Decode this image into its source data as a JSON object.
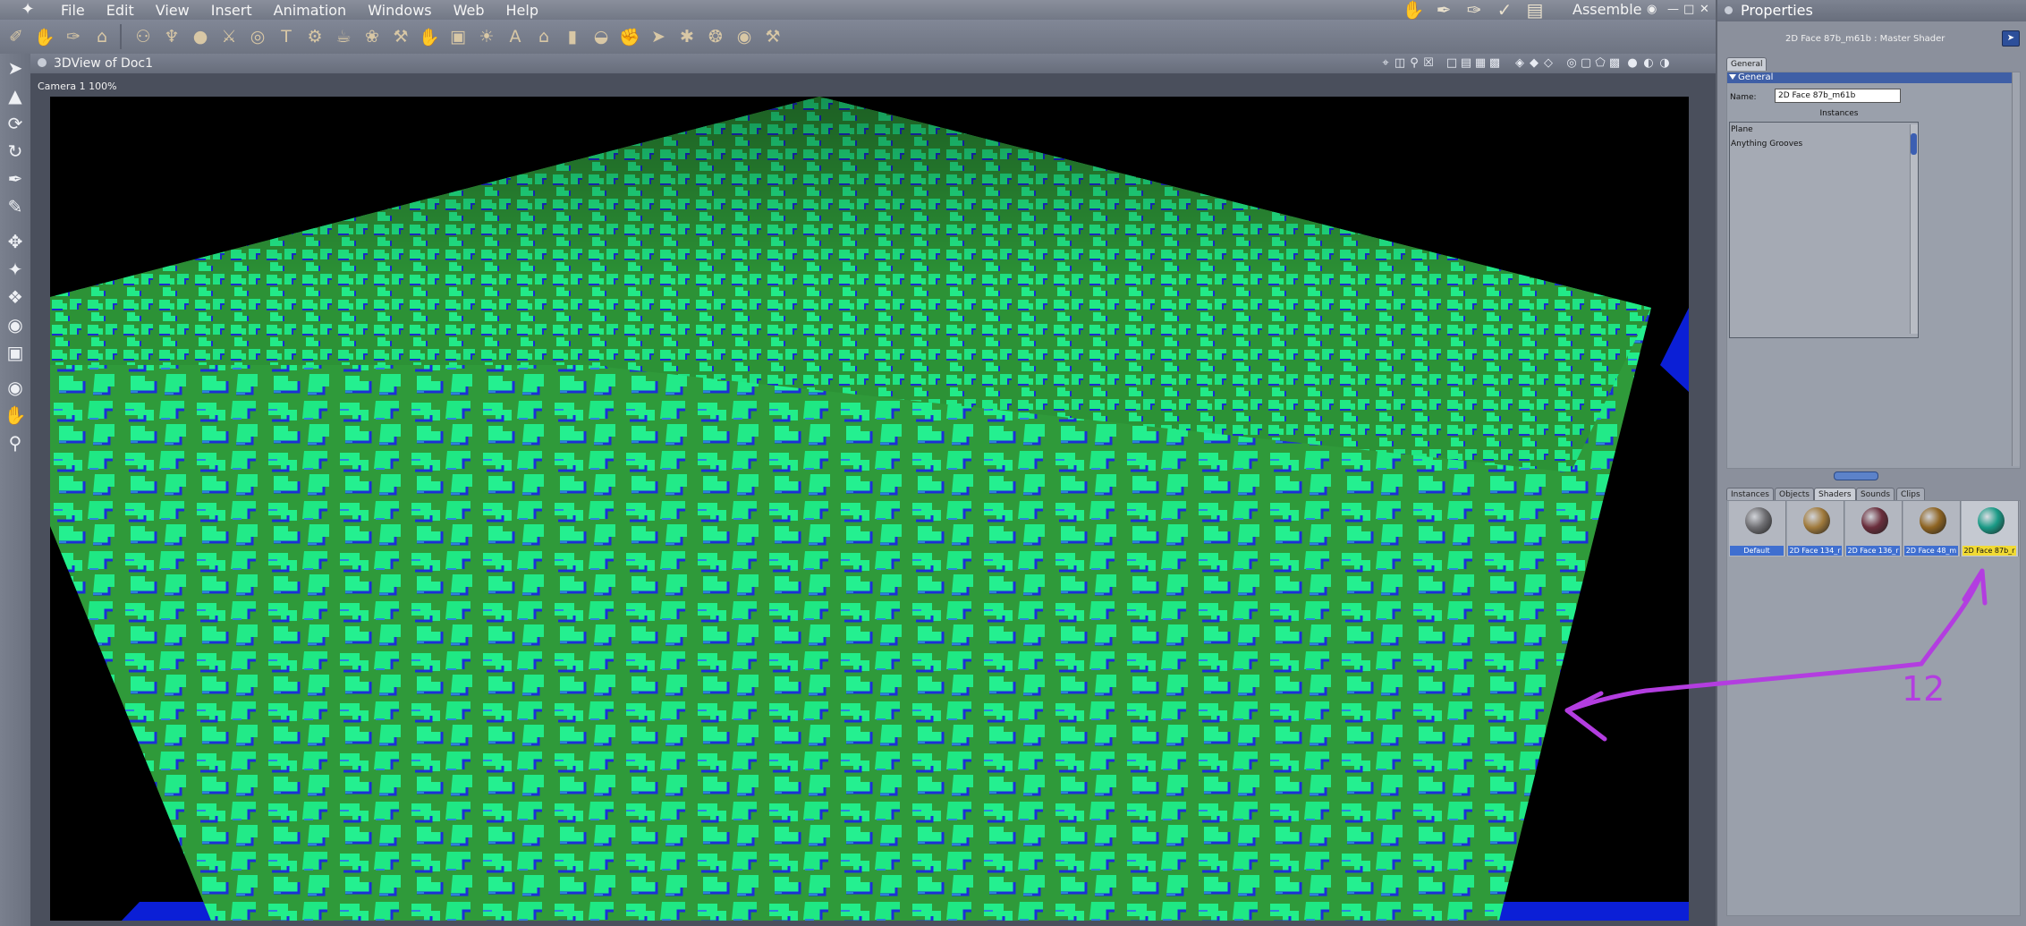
{
  "app": {
    "menus": [
      "File",
      "Edit",
      "View",
      "Insert",
      "Animation",
      "Windows",
      "Web",
      "Help"
    ],
    "room_label": "Assemble",
    "room_icons": [
      "hand-icon",
      "brush-icon",
      "pen-icon",
      "light-icon",
      "cube-icon"
    ]
  },
  "toolbar": {
    "icons": [
      "select-tool-icon",
      "hand-tool-icon",
      "draw-tool-icon",
      "sofa-icon",
      "sep",
      "group-icon",
      "lamp-icon",
      "sphere-icon",
      "figure-icon",
      "ring-icon",
      "text-icon",
      "gear-icon",
      "cup-icon",
      "bow-icon",
      "wrench-icon",
      "hand-icon",
      "cube-icon",
      "sun-icon",
      "agi-icon",
      "house-icon",
      "bottle-icon",
      "pot-icon",
      "glove-icon",
      "pointer-icon",
      "spider-icon",
      "network-icon",
      "sphere-target-icon",
      "pin-icon"
    ]
  },
  "view": {
    "title": "3DView of Doc1",
    "camera_label": "Camera 1 100%"
  },
  "properties": {
    "title": "Properties",
    "object_name": "2D Face 87b_m61b : Master Shader",
    "tab_general": "General",
    "section": "General",
    "name_label": "Name:",
    "name_value": "2D Face 87b_m61b",
    "instances_label": "Instances",
    "instances": [
      "Plane",
      "Anything Grooves"
    ]
  },
  "library": {
    "tabs": [
      "Instances",
      "Objects",
      "Shaders",
      "Sounds",
      "Clips"
    ],
    "active_tab": "Shaders",
    "shaders": [
      {
        "label": "Default",
        "color": "#6e6e72"
      },
      {
        "label": "2D Face 134_r",
        "color": "#a07a3c"
      },
      {
        "label": "2D Face 136_r",
        "color": "#6a2e3c"
      },
      {
        "label": "2D Face 48_m",
        "color": "#8e6422"
      },
      {
        "label": "2D Face 87b_r",
        "color": "#1a9a86"
      }
    ]
  },
  "annotation": {
    "label": "12",
    "color": "#b33de0"
  }
}
